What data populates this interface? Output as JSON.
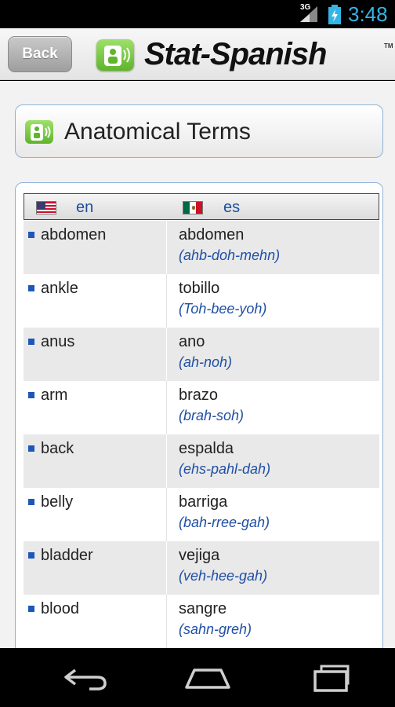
{
  "status_bar": {
    "network": "3G",
    "time": "3:48"
  },
  "header": {
    "back_label": "Back",
    "app_title": "Stat-Spanish",
    "trademark": "TM"
  },
  "section": {
    "title": "Anatomical Terms"
  },
  "table": {
    "columns": [
      {
        "code": "en",
        "flag": "us-flag-icon"
      },
      {
        "code": "es",
        "flag": "mexico-flag-icon"
      }
    ],
    "rows": [
      {
        "en": "abdomen",
        "es": "abdomen",
        "pron": "(ahb-doh-mehn)"
      },
      {
        "en": "ankle",
        "es": "tobillo",
        "pron": "(Toh-bee-yoh)"
      },
      {
        "en": "anus",
        "es": "ano",
        "pron": "(ah-noh)"
      },
      {
        "en": "arm",
        "es": "brazo",
        "pron": "(brah-soh)"
      },
      {
        "en": "back",
        "es": "espalda",
        "pron": "(ehs-pahl-dah)"
      },
      {
        "en": "belly",
        "es": "barriga",
        "pron": "(bah-rree-gah)"
      },
      {
        "en": "bladder",
        "es": "vejiga",
        "pron": "(veh-hee-gah)"
      },
      {
        "en": "blood",
        "es": "sangre",
        "pron": "(sahn-greh)"
      }
    ]
  },
  "colors": {
    "accent": "#33b5e5",
    "link_blue": "#1f4fa5",
    "bullet": "#1f57b8",
    "logo_green": "#5fb52b"
  }
}
